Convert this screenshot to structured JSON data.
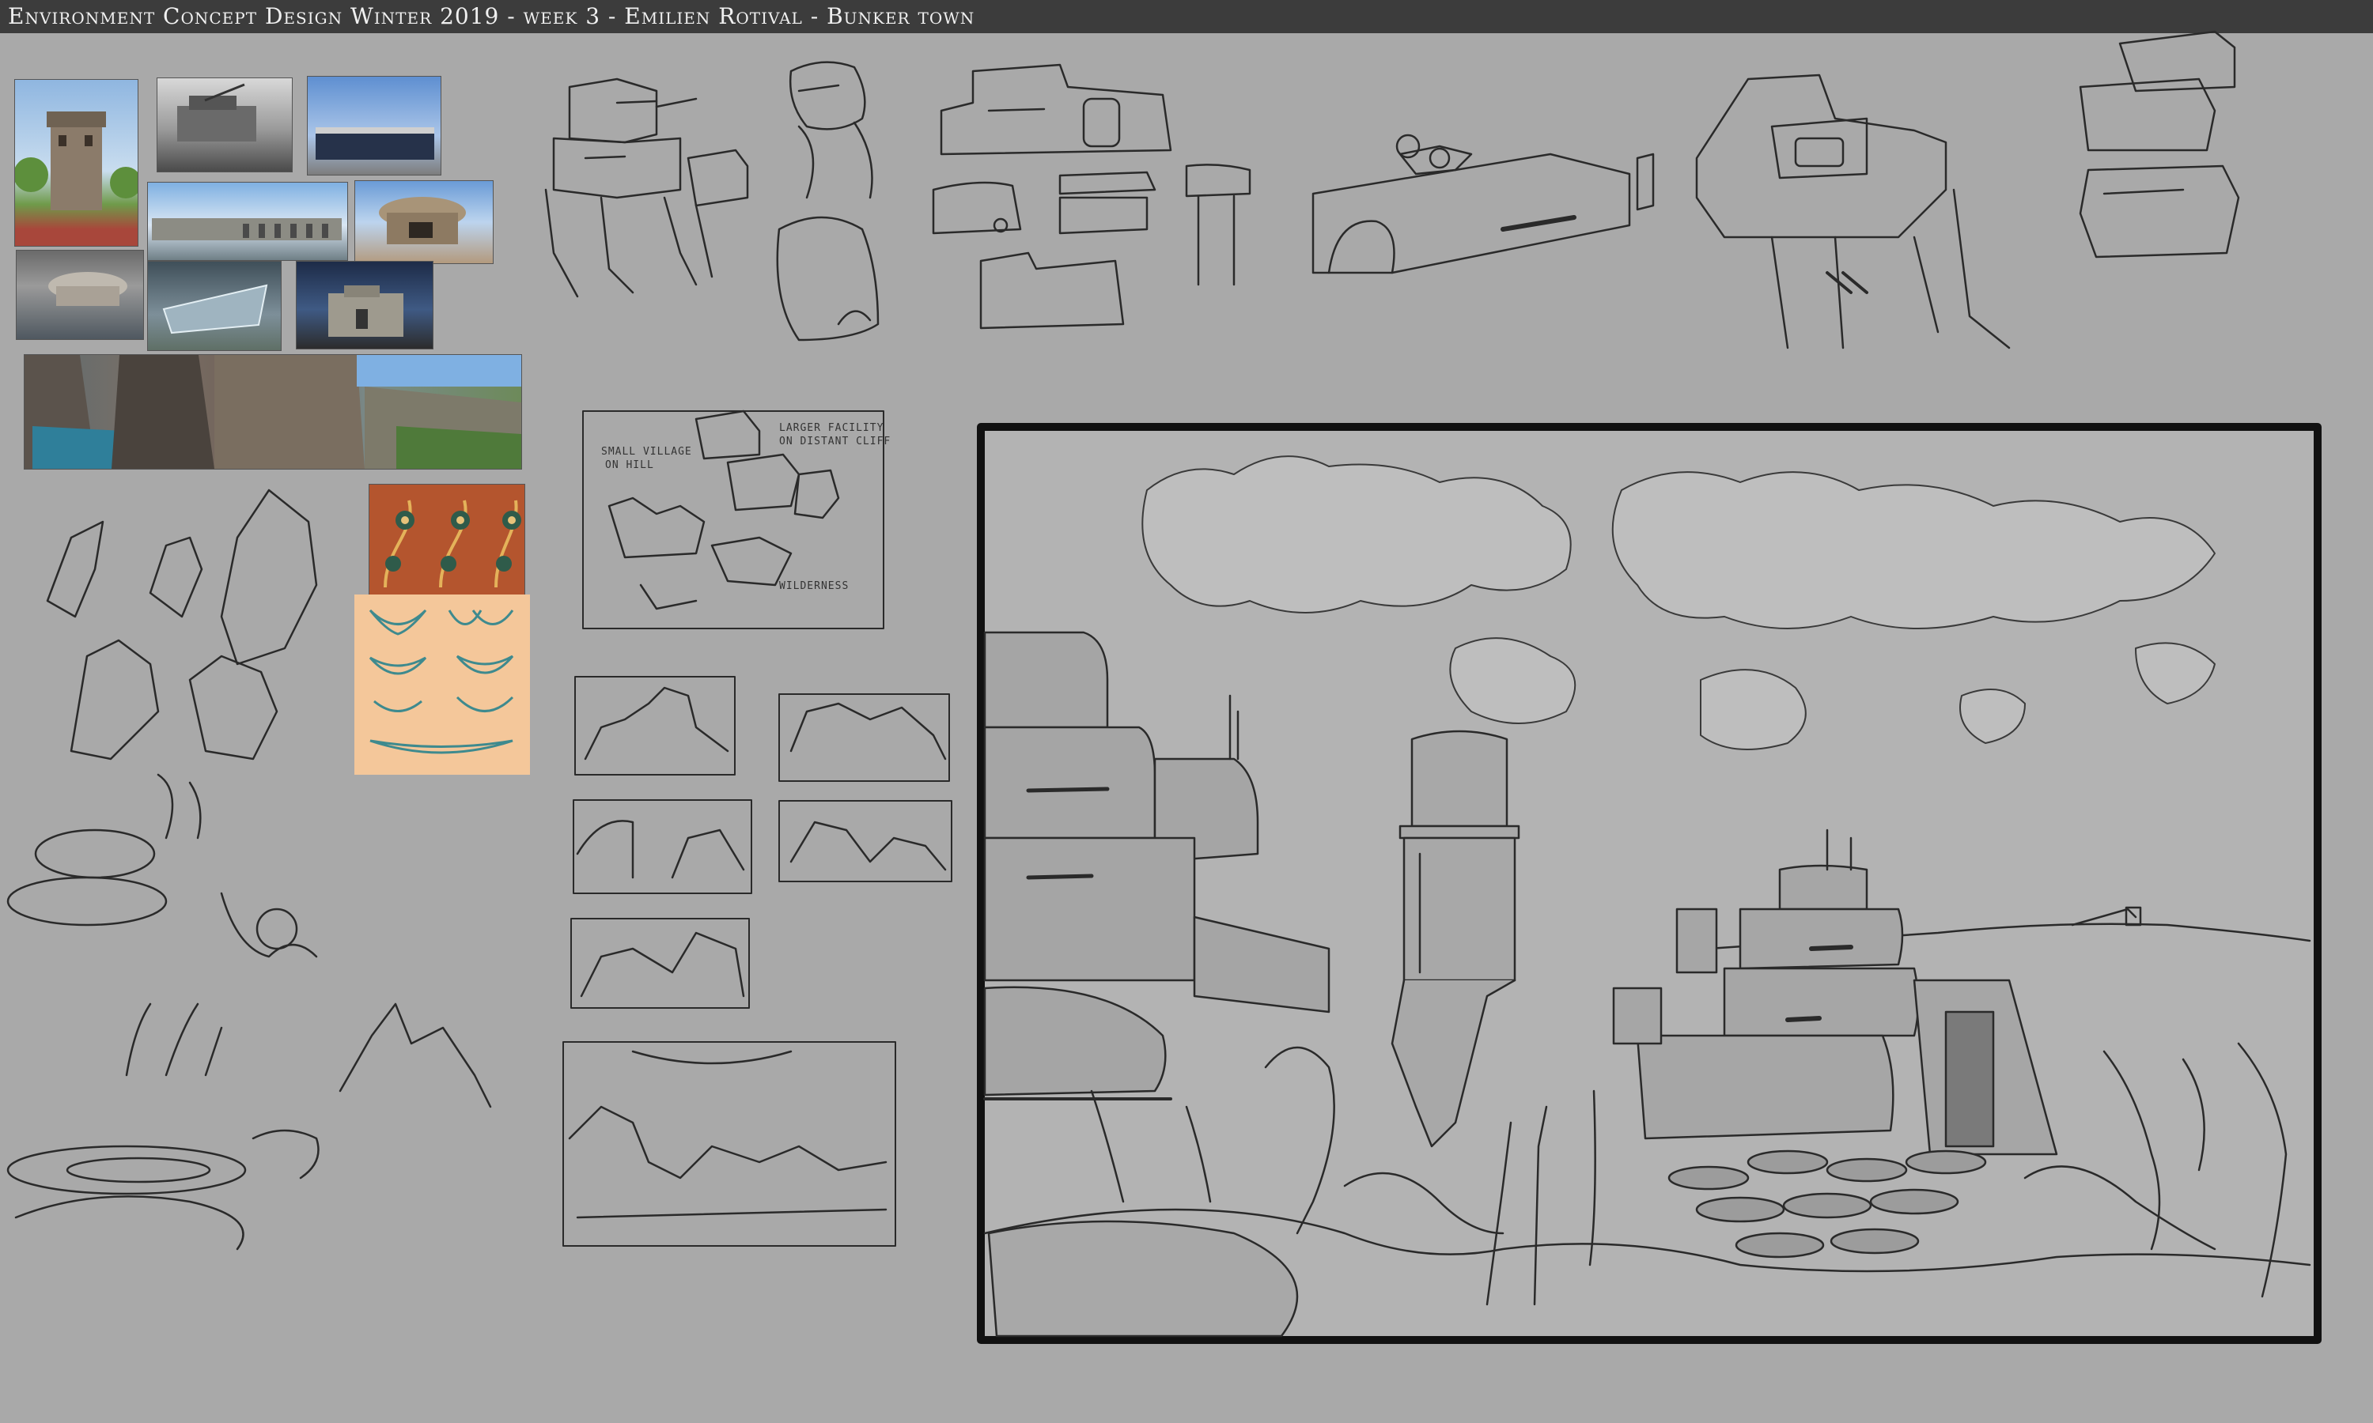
{
  "board": {
    "title": "Environment Concept Design Winter 2019 - week 3 - Emilien Rotival - Bunker town"
  },
  "thumbnail_notes": {
    "facility": "LARGER FACILITY",
    "facility_sub": "ON DISTANT CLIFF",
    "village": "SMALL VILLAGE",
    "village_sub": "ON HILL",
    "wilderness": "WILDERNESS"
  },
  "colors": {
    "background": "#a9a9a9",
    "title_bar": "#3c3c3c",
    "title_text": "#f0f0f0",
    "ink": "#2a2a2a",
    "ornament_bg": "#f4c79a",
    "ornament_ink": "#3e8a8e",
    "pattern_bg": "#b4552e"
  }
}
